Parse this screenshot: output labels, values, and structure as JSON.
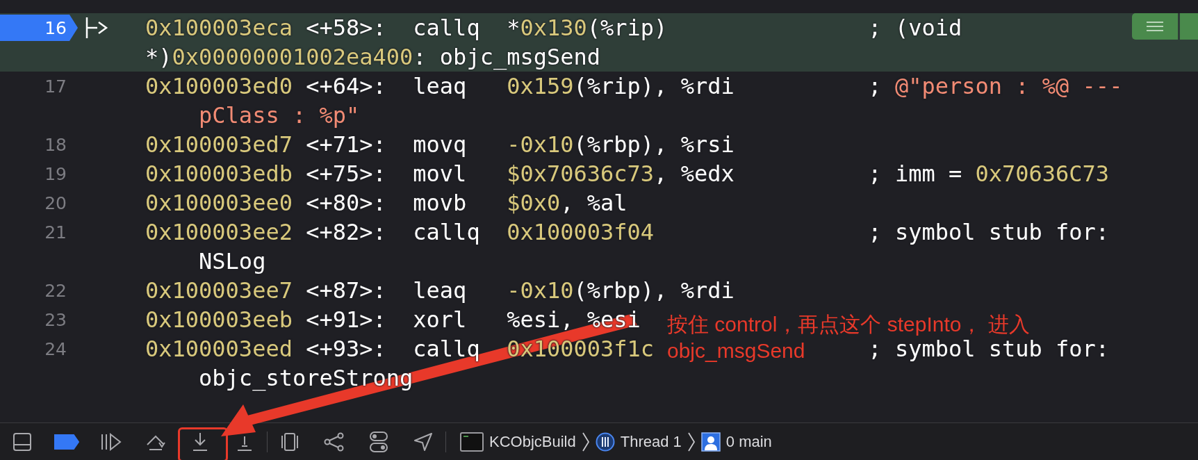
{
  "lines": [
    {
      "number": "16",
      "breakpoint": true,
      "current": true,
      "address": "0x100003eca",
      "offset": "<+58>:",
      "mnemonic": "callq",
      "operands": [
        {
          "text": "*",
          "kind": "plain"
        },
        {
          "text": "0x130",
          "kind": "number"
        },
        {
          "text": "(%rip)",
          "kind": "plain"
        }
      ],
      "comment": [
        {
          "text": "; (void",
          "kind": "plain"
        }
      ],
      "continuation": [
        {
          "text": "*)",
          "kind": "plain"
        },
        {
          "text": "0x00000001002ea400",
          "kind": "number"
        },
        {
          "text": ": objc_msgSend",
          "kind": "plain"
        }
      ]
    },
    {
      "number": "17",
      "breakpoint": false,
      "current": false,
      "address": "0x100003ed0",
      "offset": "<+64>:",
      "mnemonic": "leaq",
      "operands": [
        {
          "text": "0x159",
          "kind": "number"
        },
        {
          "text": "(%rip), %rdi",
          "kind": "plain"
        }
      ],
      "comment": [
        {
          "text": "; ",
          "kind": "plain"
        },
        {
          "text": "@\"person : %@ ---",
          "kind": "string"
        }
      ],
      "continuation": [
        {
          "text": "pClass : %p\"",
          "kind": "string"
        }
      ]
    },
    {
      "number": "18",
      "breakpoint": false,
      "current": false,
      "address": "0x100003ed7",
      "offset": "<+71>:",
      "mnemonic": "movq",
      "operands": [
        {
          "text": "-0x10",
          "kind": "number"
        },
        {
          "text": "(%rbp), %rsi",
          "kind": "plain"
        }
      ]
    },
    {
      "number": "19",
      "breakpoint": false,
      "current": false,
      "address": "0x100003edb",
      "offset": "<+75>:",
      "mnemonic": "movl",
      "operands": [
        {
          "text": "$0x70636c73",
          "kind": "number"
        },
        {
          "text": ", %edx",
          "kind": "plain"
        }
      ],
      "comment": [
        {
          "text": "; imm = ",
          "kind": "plain"
        },
        {
          "text": "0x70636C73",
          "kind": "number"
        }
      ]
    },
    {
      "number": "20",
      "breakpoint": false,
      "current": false,
      "address": "0x100003ee0",
      "offset": "<+80>:",
      "mnemonic": "movb",
      "operands": [
        {
          "text": "$0x0",
          "kind": "number"
        },
        {
          "text": ", %al",
          "kind": "plain"
        }
      ]
    },
    {
      "number": "21",
      "breakpoint": false,
      "current": false,
      "address": "0x100003ee2",
      "offset": "<+82>:",
      "mnemonic": "callq",
      "operands": [
        {
          "text": "0x100003f04",
          "kind": "number"
        }
      ],
      "comment": [
        {
          "text": "; symbol stub for:",
          "kind": "plain"
        }
      ],
      "continuation": [
        {
          "text": "NSLog",
          "kind": "plain"
        }
      ]
    },
    {
      "number": "22",
      "breakpoint": false,
      "current": false,
      "address": "0x100003ee7",
      "offset": "<+87>:",
      "mnemonic": "leaq",
      "operands": [
        {
          "text": "-0x10",
          "kind": "number"
        },
        {
          "text": "(%rbp), %rdi",
          "kind": "plain"
        }
      ]
    },
    {
      "number": "23",
      "breakpoint": false,
      "current": false,
      "address": "0x100003eeb",
      "offset": "<+91>:",
      "mnemonic": "xorl",
      "operands": [
        {
          "text": "%esi, %esi",
          "kind": "plain"
        }
      ]
    },
    {
      "number": "24",
      "breakpoint": false,
      "current": false,
      "address": "0x100003eed",
      "offset": "<+93>:",
      "mnemonic": "callq",
      "operands": [
        {
          "text": "0x100003f1c",
          "kind": "number"
        }
      ],
      "comment": [
        {
          "text": "; symbol stub for:",
          "kind": "plain"
        }
      ],
      "continuation": [
        {
          "text": "objc_storeStrong",
          "kind": "plain"
        }
      ]
    }
  ],
  "toolbar": {
    "breakpoints_active": true,
    "buttons": [
      {
        "kind": "panel"
      },
      {
        "kind": "breakpoints"
      },
      {
        "kind": "continue"
      },
      {
        "kind": "step-over"
      },
      {
        "kind": "step-into"
      },
      {
        "kind": "step-out"
      },
      {
        "kind": "divider"
      },
      {
        "kind": "view-debugger"
      },
      {
        "kind": "memory-graph"
      },
      {
        "kind": "environment"
      },
      {
        "kind": "location"
      },
      {
        "kind": "divider"
      }
    ],
    "breadcrumb": [
      {
        "kind": "target",
        "text": "KCObjcBuild"
      },
      {
        "kind": "thread",
        "text": "Thread 1"
      },
      {
        "kind": "frame",
        "text": "0 main"
      }
    ]
  },
  "annotation": {
    "lines": [
      "按住 control，再点这个 stepInto， 进入",
      "objc_msgSend"
    ]
  }
}
